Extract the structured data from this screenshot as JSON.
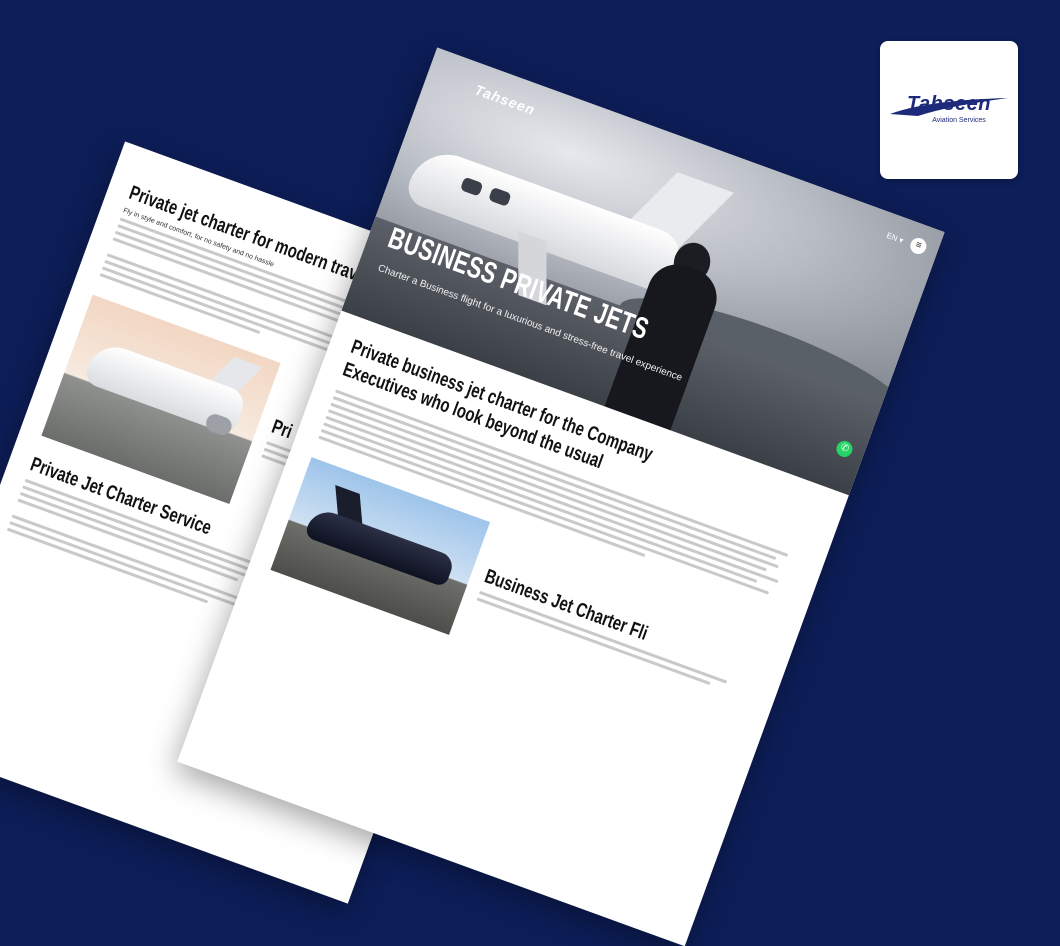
{
  "logo_card": {
    "brand": "Tahseen",
    "tagline": "Aviation Services"
  },
  "front_page": {
    "nav": {
      "logo": "Tahseen",
      "language": "EN ▾",
      "menu_icon": "menu-icon"
    },
    "hero": {
      "title": "BUSINESS PRIVATE JETS",
      "subtitle": "Charter a Business flight for a luxurious and stress-free travel experience"
    },
    "section1": {
      "title_line1": "Private business jet charter for the Company",
      "title_line2": "Executives who look beyond the usual"
    },
    "section2": {
      "title": "Business Jet Charter Fli"
    }
  },
  "back_page": {
    "title": "Private jet charter for modern travelers",
    "lead": "Fly in style and comfort, for no safety and no hassle",
    "service_title": "Private Jet Charter Service",
    "side_heading": "Pri"
  },
  "colors": {
    "background": "#0d1e58",
    "brand": "#1d2a7a",
    "whatsapp": "#25d366"
  }
}
